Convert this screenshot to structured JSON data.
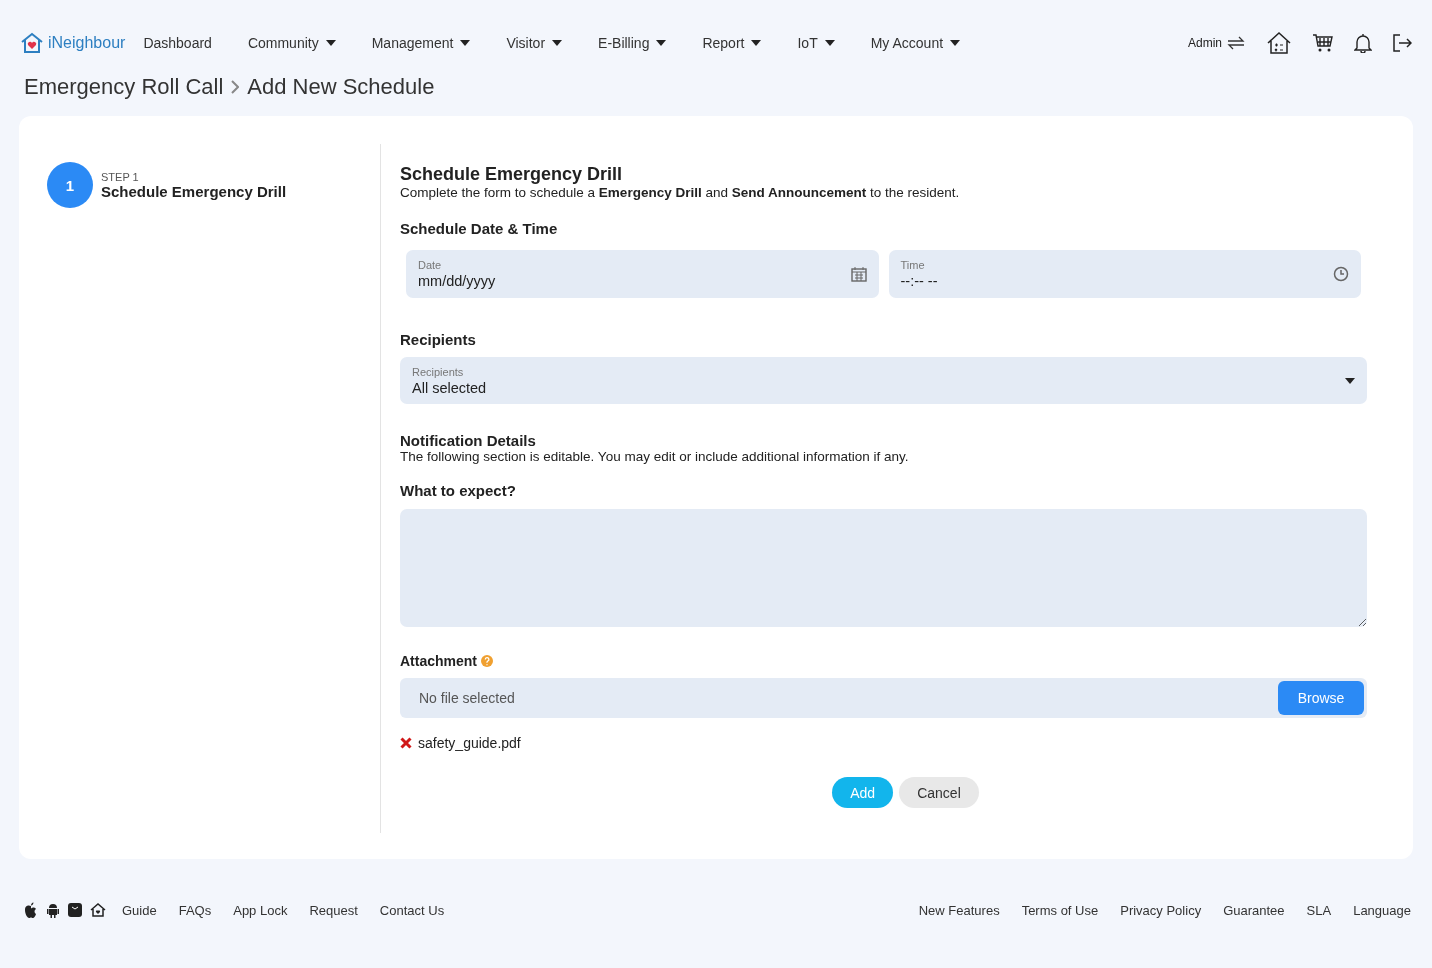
{
  "brand": {
    "name": "iNeighbour"
  },
  "nav": [
    {
      "label": "Dashboard",
      "dropdown": false
    },
    {
      "label": "Community",
      "dropdown": true
    },
    {
      "label": "Management",
      "dropdown": true
    },
    {
      "label": "Visitor",
      "dropdown": true
    },
    {
      "label": "E-Billing",
      "dropdown": true
    },
    {
      "label": "Report",
      "dropdown": true
    },
    {
      "label": "IoT",
      "dropdown": true
    },
    {
      "label": "My Account",
      "dropdown": true
    }
  ],
  "user": {
    "role": "Admin"
  },
  "breadcrumb": [
    "Emergency Roll Call",
    "Add New Schedule"
  ],
  "steps": [
    {
      "number": "1",
      "label": "STEP 1",
      "title": "Schedule Emergency Drill",
      "selected": true
    }
  ],
  "form": {
    "title": "Schedule Emergency Drill",
    "intro": "Complete the form to schedule a **Emergency Drill** and **Send Announcement** to the resident.",
    "datetime_heading": "Schedule Date & Time",
    "date": {
      "label": "Date",
      "placeholder": "mm/dd/yyyy"
    },
    "time": {
      "label": "Time",
      "placeholder": "--:-- --"
    },
    "recipients_heading": "Recipients",
    "recipients": {
      "label": "Recipients",
      "value": "All selected"
    },
    "notification_heading": "Notification Details",
    "notification_note": "The following section is editable. You may edit or include additional information if any.",
    "expect_heading": "What to expect?",
    "attachment_heading": "Attachment",
    "file_status": "No file selected",
    "browse_button": "Browse",
    "files": [
      "safety_guide.pdf"
    ],
    "add_button": "Add",
    "cancel_button": "Cancel"
  },
  "footer": {
    "left_links": [
      "Guide",
      "FAQs",
      "App Lock",
      "Request",
      "Contact Us"
    ],
    "right_links": [
      "New Features",
      "Terms of Use",
      "Privacy Policy",
      "Guarantee",
      "SLA",
      "Language"
    ]
  }
}
